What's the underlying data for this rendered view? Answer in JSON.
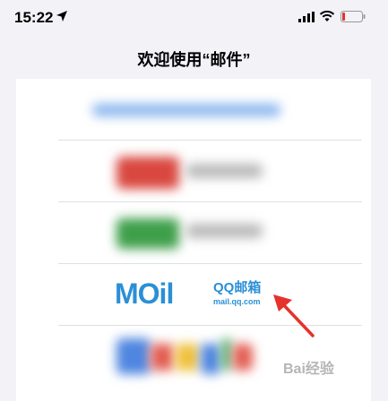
{
  "status_bar": {
    "time": "15:22",
    "icons": [
      "location-arrow-icon",
      "cellular-signal-icon",
      "wifi-icon",
      "battery-low-icon"
    ]
  },
  "nav": {
    "title": "欢迎使用“邮件”"
  },
  "providers": [
    {
      "id": "exchange",
      "blurred": true,
      "accent": "#4a90e2"
    },
    {
      "id": "163",
      "blurred": true,
      "accent": "#d93a32"
    },
    {
      "id": "126",
      "blurred": true,
      "accent": "#2e9a3e"
    },
    {
      "id": "qq",
      "blurred": false,
      "logo_word": "MOil",
      "name": "QQ邮箱",
      "domain": "mail.qq.com",
      "accent": "#2b8fd6"
    },
    {
      "id": "google",
      "blurred": true,
      "accent": "#4285f4"
    }
  ],
  "annotation": {
    "arrow_color": "#e5322d"
  },
  "watermark": {
    "text": "Bai经验"
  }
}
